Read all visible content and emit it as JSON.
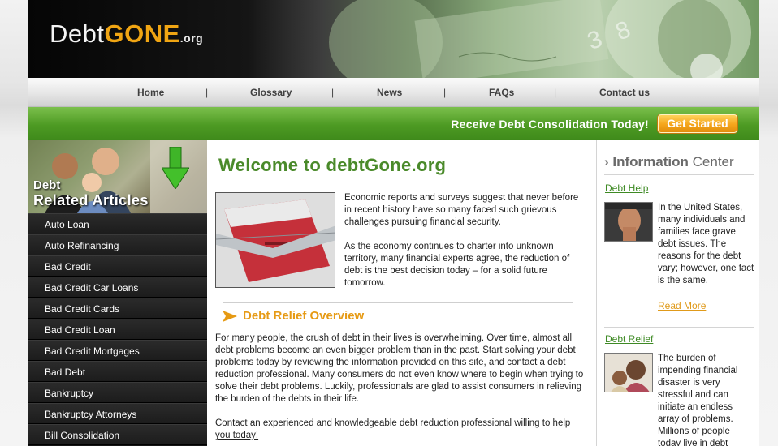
{
  "logo": {
    "part1": "Debt",
    "part2": "GONE",
    "part3": ".org"
  },
  "nav": {
    "items": [
      "Home",
      "Glossary",
      "News",
      "FAQs",
      "Contact us"
    ],
    "separator": "|"
  },
  "banner": {
    "text": "Receive Debt Consolidation Today!",
    "button": "Get Started"
  },
  "sidebar": {
    "title_line1": "Debt",
    "title_line2": "Related Articles",
    "items": [
      "Auto Loan",
      "Auto Refinancing",
      "Bad Credit",
      "Bad Credit Car Loans",
      "Bad Credit Cards",
      "Bad Credit Loan",
      "Bad Credit Mortgages",
      "Bad Debt",
      "Bankruptcy",
      "Bankruptcy Attorneys",
      "Bill Consolidation"
    ]
  },
  "main": {
    "welcome": "Welcome to debtGone.org",
    "intro_p1": "Economic reports and surveys suggest that never before in recent history have so many faced such grievous challenges pursuing financial security.",
    "intro_p2": "As the economy continues to charter into unknown territory, many financial experts agree, the reduction of debt is the best decision today – for a solid future tomorrow.",
    "section_title": "Debt Relief Overview",
    "body": "For many people, the crush of debt in their lives is overwhelming. Over time, almost all debt problems become an even bigger problem than in the past. Start solving your debt problems today by reviewing the information provided on this site, and contact a debt reduction professional. Many consumers do not even know where to begin when trying to solve their debt problems. Luckily, professionals are glad to assist consumers in relieving the burden of the debts in their life.",
    "cta": "Contact an experienced and knowledgeable debt reduction professional willing to help you today!"
  },
  "info_center": {
    "chevron": "›",
    "title_bold": "Information",
    "title_light": "Center",
    "debt_help": {
      "link": "Debt Help",
      "text": "In the United States, many individuals and families face grave debt issues. The reasons for the debt vary; however, one fact is the same.",
      "read_more": "Read More"
    },
    "debt_relief": {
      "link": "Debt Relief",
      "text": "The burden of impending financial disaster is very stressful and can initiate an endless array of problems. Millions of people today live in debt"
    }
  },
  "colors": {
    "green": "#4a8a2a",
    "orange": "#e69a14",
    "banner_green": "#4d9a23"
  }
}
